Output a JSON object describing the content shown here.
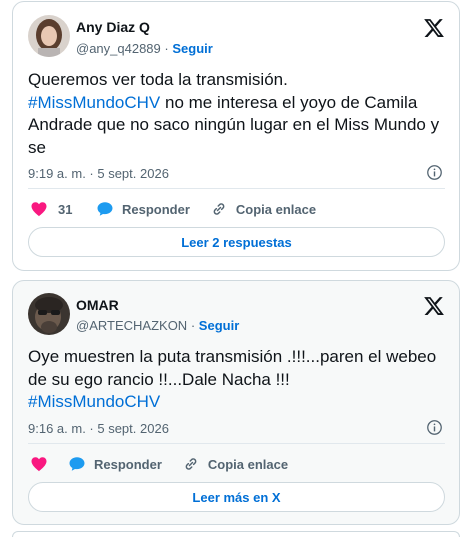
{
  "tweets": [
    {
      "name": "Any Diaz Q",
      "handle": "@any_q42889",
      "separator": "·",
      "follow_label": "Seguir",
      "text_line1": "Queremos ver toda la transmisión.",
      "hashtag": "#MissMundoCHV",
      "text_after_hashtag": " no me interesa el yoyo de Camila Andrade que no saco ningún lugar en el Miss Mundo y se",
      "timestamp": "9:19 a. m. · 5 sept. 2026",
      "like_count": "31",
      "reply_label": "Responder",
      "copy_label": "Copia enlace",
      "footer_button": "Leer 2 respuestas",
      "like_color": "#f91880"
    },
    {
      "name": "OMAR",
      "handle": "@ARTECHAZKON",
      "separator": "·",
      "follow_label": "Seguir",
      "text_main": "Oye muestren la puta transmisión .!!!...paren el webeo de su ego rancio !!...Dale Nacha !!!",
      "hashtag": "#MissMundoCHV",
      "timestamp": "9:16 a. m. · 5 sept. 2026",
      "reply_label": "Responder",
      "copy_label": "Copia enlace",
      "footer_button": "Leer más en X",
      "like_color": "#f91880"
    }
  ],
  "colors": {
    "link": "#006fd6",
    "muted": "#536471",
    "reply_bubble": "#1d9bf0"
  },
  "icons": [
    "x-logo-icon",
    "info-icon",
    "heart-icon",
    "reply-bubble-icon",
    "link-icon"
  ]
}
